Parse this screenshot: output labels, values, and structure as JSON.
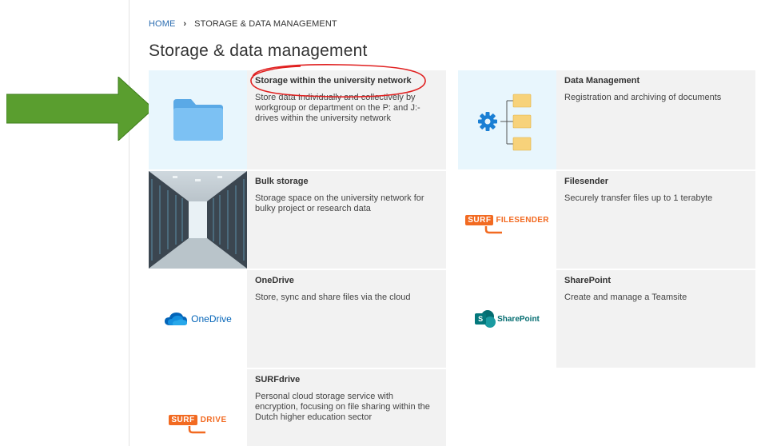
{
  "breadcrumb": {
    "home": "HOME",
    "separator": "›",
    "current": "STORAGE & DATA MANAGEMENT"
  },
  "page_title": "Storage & data management",
  "cards": [
    {
      "title": "Storage within the university network",
      "description": "Store data Individually and collectively by workgroup or department on the P: and J:-drives within the university network",
      "icon": "folder-icon"
    },
    {
      "title": "Data Management",
      "description": "Registration and archiving of documents",
      "icon": "gear-folders-icon"
    },
    {
      "title": "Bulk storage",
      "description": "Storage space on the university network for bulky project or research data",
      "icon": "server-room-image"
    },
    {
      "title": "Filesender",
      "description": "Securely transfer files up to 1 terabyte",
      "icon": "surf-filesender-logo",
      "logo_parts": [
        "SURF",
        "FILESENDER"
      ]
    },
    {
      "title": "OneDrive",
      "description": "Store, sync and share files via the cloud",
      "icon": "onedrive-logo",
      "logo_text": "OneDrive"
    },
    {
      "title": "SharePoint",
      "description": "Create and manage a Teamsite",
      "icon": "sharepoint-logo",
      "logo_text": "SharePoint",
      "logo_letter": "S"
    },
    {
      "title": "SURFdrive",
      "description": "Personal cloud storage service with encryption, focusing on file sharing within the Dutch higher education sector",
      "icon": "surfdrive-logo",
      "logo_parts": [
        "SURF",
        "DRIVE"
      ]
    }
  ],
  "colors": {
    "arrow": "#5a9e2f",
    "annotation": "#e02020",
    "link": "#2b6cb0",
    "surf_orange": "#f26a21",
    "card_bg": "#f2f2f2",
    "thumb_blue": "#e8f6fd"
  }
}
